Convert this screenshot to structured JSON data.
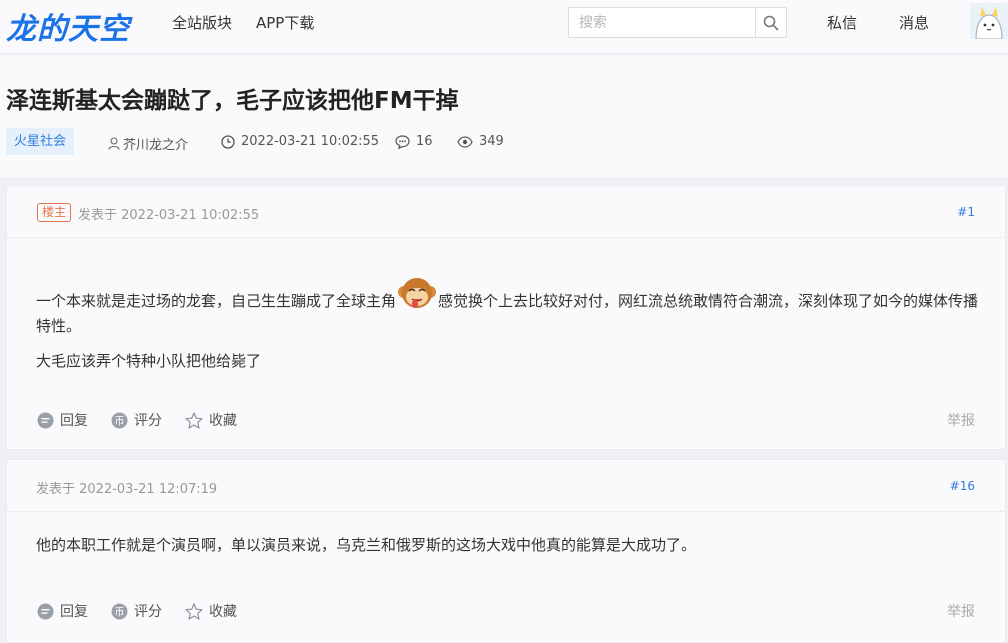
{
  "header": {
    "logo": "龙的天空",
    "nav": [
      "全站版块",
      "APP下载"
    ],
    "search_placeholder": "搜索",
    "messages": "私信",
    "notifications": "消息"
  },
  "thread": {
    "title": "泽连斯基太会蹦跶了，毛子应该把他FM干掉",
    "category": "火星社会",
    "author": "芥川龙之介",
    "datetime": "2022-03-21 10:02:55",
    "replies": "16",
    "views": "349"
  },
  "posts": [
    {
      "badge": "楼主",
      "time": "发表于 2022-03-21 10:02:55",
      "floor": "#1",
      "para1_before": "一个本来就是走过场的龙套，自己生生蹦成了全球主角",
      "para1_after": "感觉换个上去比较好对付，网红流总统敢情符合潮流，深刻体现了如今的媒体传播特性。",
      "para2": "大毛应该弄个特种小队把他给毙了"
    },
    {
      "time": "发表于 2022-03-21 12:07:19",
      "floor": "#16",
      "para1": "他的本职工作就是个演员啊，单以演员来说，乌克兰和俄罗斯的这场大戏中他真的能算是大成功了。"
    }
  ],
  "actions": {
    "reply": "回复",
    "rate": "评分",
    "favorite": "收藏",
    "report": "举报"
  },
  "colors": {
    "accent": "#1a73e8",
    "link": "#2f7de1",
    "op_badge": "#e5764e"
  }
}
